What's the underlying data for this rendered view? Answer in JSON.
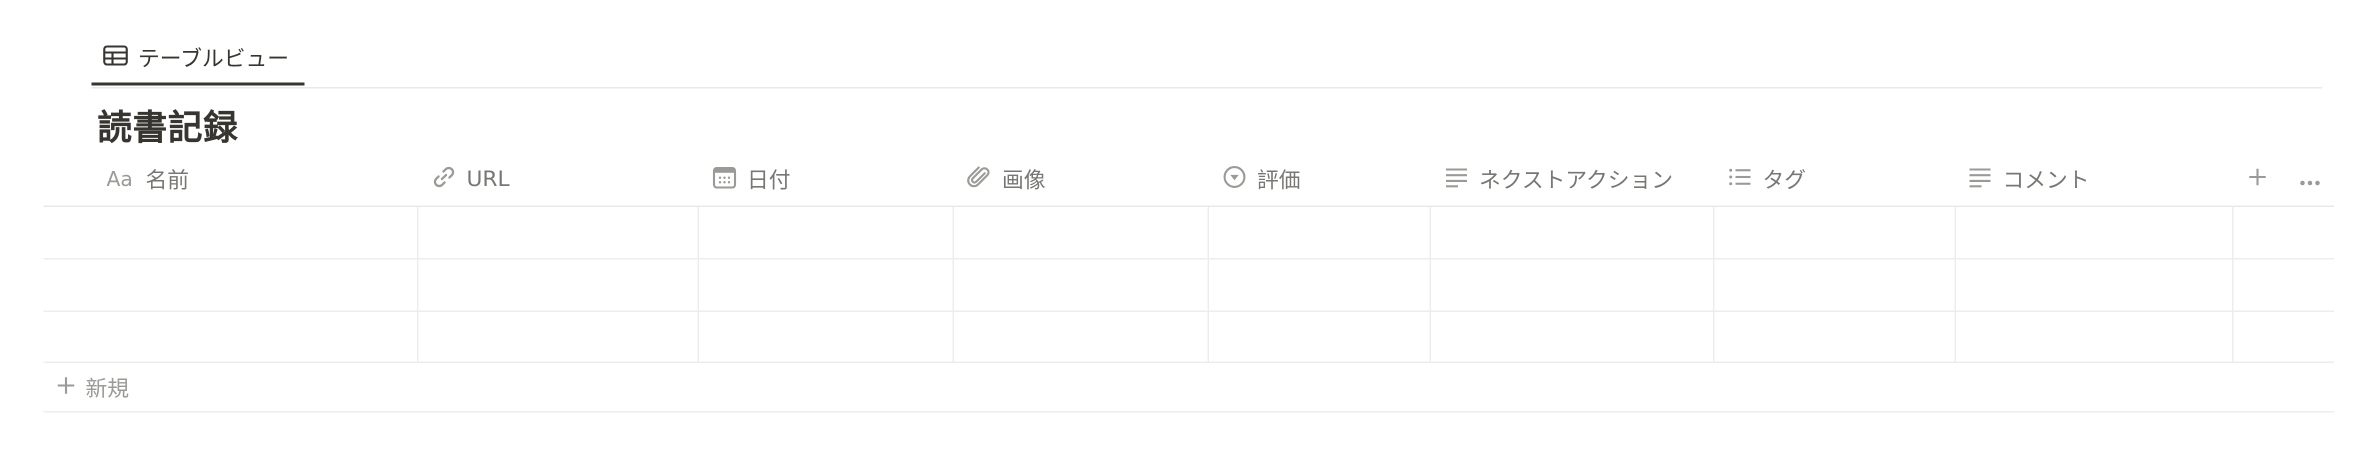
{
  "view_tabs": [
    {
      "label": "テーブルビュー",
      "icon": "table-icon",
      "active": true
    }
  ],
  "database": {
    "title": "読書記録"
  },
  "columns": [
    {
      "label": "名前",
      "icon": "title-icon",
      "icon_text": "Aa"
    },
    {
      "label": "URL",
      "icon": "link-icon"
    },
    {
      "label": "日付",
      "icon": "calendar-icon"
    },
    {
      "label": "画像",
      "icon": "paperclip-icon"
    },
    {
      "label": "評価",
      "icon": "select-icon"
    },
    {
      "label": "ネクストアクション",
      "icon": "text-icon"
    },
    {
      "label": "タグ",
      "icon": "multi-select-icon"
    },
    {
      "label": "コメント",
      "icon": "text-icon"
    }
  ],
  "rows": [
    [
      "",
      "",
      "",
      "",
      "",
      "",
      "",
      ""
    ],
    [
      "",
      "",
      "",
      "",
      "",
      "",
      "",
      ""
    ],
    [
      "",
      "",
      "",
      "",
      "",
      "",
      "",
      ""
    ]
  ],
  "new_row": {
    "label": "新規"
  },
  "colors": {
    "text": "#37352f",
    "muted": "#787774",
    "border": "#e9e9e7"
  }
}
